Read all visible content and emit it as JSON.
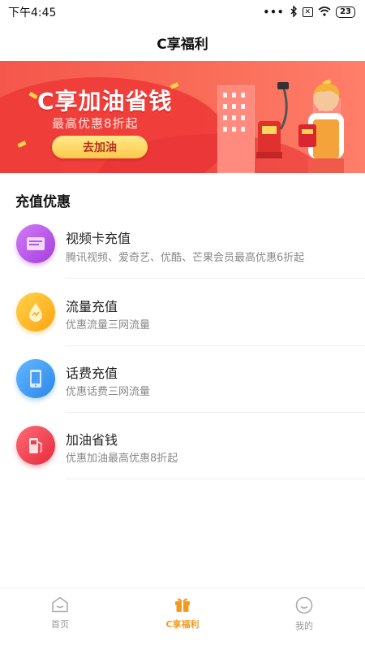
{
  "status_bar": {
    "time": "下午4:45",
    "battery": "23"
  },
  "header": {
    "title": "C享福利"
  },
  "banner": {
    "title": "C享加油省钱",
    "subtitle": "最高优惠8折起",
    "button_label": "去加油"
  },
  "section": {
    "title": "充值优惠"
  },
  "items": [
    {
      "title": "视频卡充值",
      "desc": "腾讯视频、爱奇艺、优酷、芒果会员最高优惠6折起",
      "icon": "video-card-icon",
      "color": "#b94de8"
    },
    {
      "title": "流量充值",
      "desc": "优惠流量三网流量",
      "icon": "data-drop-icon",
      "color": "#ffb21f"
    },
    {
      "title": "话费充值",
      "desc": "优惠话费三网流量",
      "icon": "phone-icon",
      "color": "#3f9cf2"
    },
    {
      "title": "加油省钱",
      "desc": "优惠加油最高优惠8折起",
      "icon": "fuel-pump-icon",
      "color": "#f2434f"
    }
  ],
  "nav": {
    "home": "首页",
    "welfare": "C享福利",
    "mine": "我的",
    "active_color": "#f39a1c"
  }
}
